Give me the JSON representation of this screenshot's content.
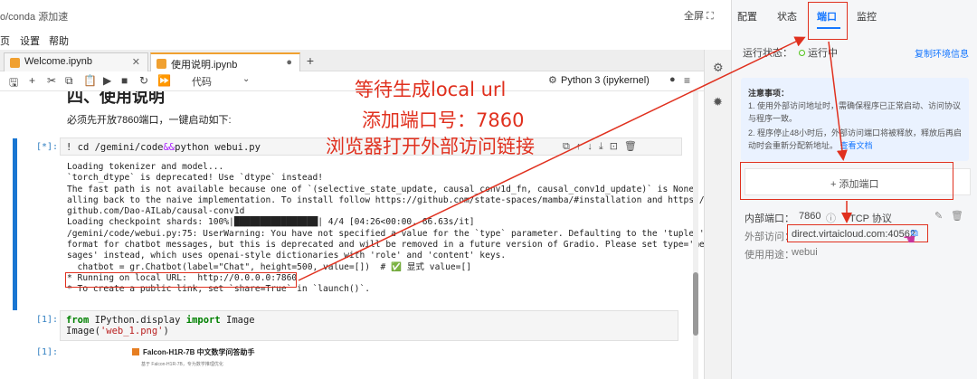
{
  "topbar": {
    "breadcrumb": "o/conda 源加速",
    "fullscreen": "全屏 ⛶"
  },
  "menubar": [
    "页",
    "设置",
    "帮助"
  ],
  "tabs": [
    {
      "label": "Welcome.ipynb"
    },
    {
      "label": "使用说明.ipynb"
    }
  ],
  "toolbar": {
    "cell_type": "代码",
    "kernel": "Python 3 (ipykernel)"
  },
  "notebook": {
    "heading_fragment": "四、使用说明",
    "md_line": "必须先开放7860端口，一键启动如下:",
    "cell1": {
      "prompt": "[*]:",
      "cmd": "! cd /gemini/code",
      "and": "&&",
      "rest": "python webui.py"
    },
    "output": [
      "Loading tokenizer and model...",
      "`torch_dtype` is deprecated! Use `dtype` instead!",
      "The fast path is not available because one of `(selective_state_update, causal_conv1d_fn, causal_conv1d_update)` is None. F",
      "alling back to the naive implementation. To install follow https://github.com/state-spaces/mamba/#installation and https://",
      "github.com/Dao-AILab/causal-conv1d",
      "Loading checkpoint shards: 100%|████████████████| 4/4 [04:26<00:00, 66.63s/it]",
      "/gemini/code/webui.py:75: UserWarning: You have not specified a value for the `type` parameter. Defaulting to the 'tuples'",
      "format for chatbot messages, but this is deprecated and will be removed in a future version of Gradio. Please set type='mes",
      "sages' instead, which uses openai-style dictionaries with 'role' and 'content' keys.",
      "  chatbot = gr.Chatbot(label=\"Chat\", height=500, value=[])  # ✅ 显式 value=[]",
      "* Running on local URL:  http://0.0.0.0:7860",
      "* To create a public link, set `share=True` in `launch()`."
    ],
    "cell2": {
      "prompt": "[1]:",
      "line1_kw": "from",
      "line1_mod": " IPython.display ",
      "line1_kw2": "import",
      "line1_cls": " Image",
      "line2_fn": "Image(",
      "line2_str": "'web_1.png'",
      "line2_end": ")"
    },
    "cell3": {
      "prompt": "[1]:",
      "img_title": "Falcon-H1R-7B 中文数学问答助手",
      "img_sub": "基于 Falcon-H1R-7B，专为数学推理优化"
    }
  },
  "annotations": [
    "等待生成local url",
    "添加端口号：7860",
    "浏览器打开外部访问链接"
  ],
  "right_panel": {
    "tabs": [
      "配置",
      "状态",
      "端口",
      "监控"
    ],
    "active_tab": "端口",
    "status_label": "运行状态：",
    "status_value": "运行中",
    "copy_env": "复制环境信息",
    "notice_title": "注意事项：",
    "notice_1": "1. 使用外部访问地址时，需确保程序已正常启动、访问协议与程序一致。",
    "notice_2a": "2. 程序停止48小时后，外部访问端口将被释放，释放后再启动时会重新分配新地址。",
    "notice_link": "查看文档",
    "add_port": "+ 添加端口",
    "inner_port_label": "内部端口：",
    "inner_port_value": "7860",
    "protocol": "TCP 协议",
    "ext_label": "外部访问：",
    "ext_value": "direct.virtaicloud.com:40562",
    "usage_label": "使用用途：",
    "usage_value": "webui"
  },
  "colors": {
    "accent": "#1677ff",
    "annotation": "#e0301e",
    "running": "#52c41a"
  }
}
